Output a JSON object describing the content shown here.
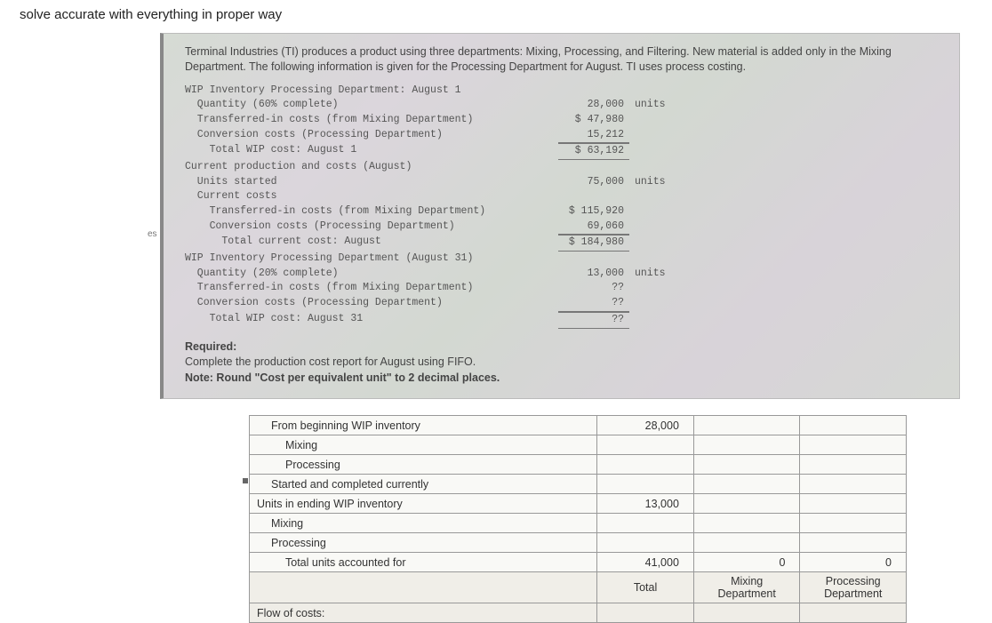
{
  "instruction": "solve accurate with everything in proper way",
  "intro": "Terminal Industries (TI) produces a product using three departments: Mixing, Processing, and Filtering. New material is added only in the Mixing Department. The following information is given for the Processing Department for August. TI uses process costing.",
  "side_tab": "es",
  "block": {
    "h1": "WIP Inventory Processing Department: August 1",
    "r1_label": "  Quantity (60% complete)",
    "r1_val": "28,000",
    "r1_unit": "units",
    "r2_label": "  Transferred-in costs (from Mixing Department)",
    "r2_val": "$ 47,980",
    "r3_label": "  Conversion costs (Processing Department)",
    "r3_val": "15,212",
    "r4_label": "    Total WIP cost: August 1",
    "r4_val": "$ 63,192",
    "h2": "Current production and costs (August)",
    "r5_label": "  Units started",
    "r5_val": "75,000",
    "r5_unit": "units",
    "r6_label": "  Current costs",
    "r7_label": "    Transferred-in costs (from Mixing Department)",
    "r7_val": "$ 115,920",
    "r8_label": "    Conversion costs (Processing Department)",
    "r8_val": "69,060",
    "r9_label": "      Total current cost: August",
    "r9_val": "$ 184,980",
    "h3": "WIP Inventory Processing Department (August 31)",
    "r10_label": "  Quantity (20% complete)",
    "r10_val": "13,000",
    "r10_unit": "units",
    "r11_label": "  Transferred-in costs (from Mixing Department)",
    "r11_val": "??",
    "r12_label": "  Conversion costs (Processing Department)",
    "r12_val": "??",
    "r13_label": "    Total WIP cost: August 31",
    "r13_val": "??"
  },
  "req": {
    "title": "Required:",
    "line": "Complete the production cost report for August using FIFO.",
    "note": "Note: Round \"Cost per equivalent unit\" to 2 decimal places."
  },
  "ws": {
    "r0": "From beginning WIP inventory",
    "r0_v": "28,000",
    "r1": "Mixing",
    "r2": "Processing",
    "r3": "Started and completed currently",
    "r4": "Units in ending WIP inventory",
    "r4_v": "13,000",
    "r5": "Mixing",
    "r6": "Processing",
    "r7": "Total units accounted for",
    "r7_v1": "41,000",
    "r7_v2": "0",
    "r7_v3": "0",
    "hdr_total": "Total",
    "hdr_mix": "Mixing Department",
    "hdr_proc": "Processing Department",
    "flow": "Flow of costs:"
  }
}
